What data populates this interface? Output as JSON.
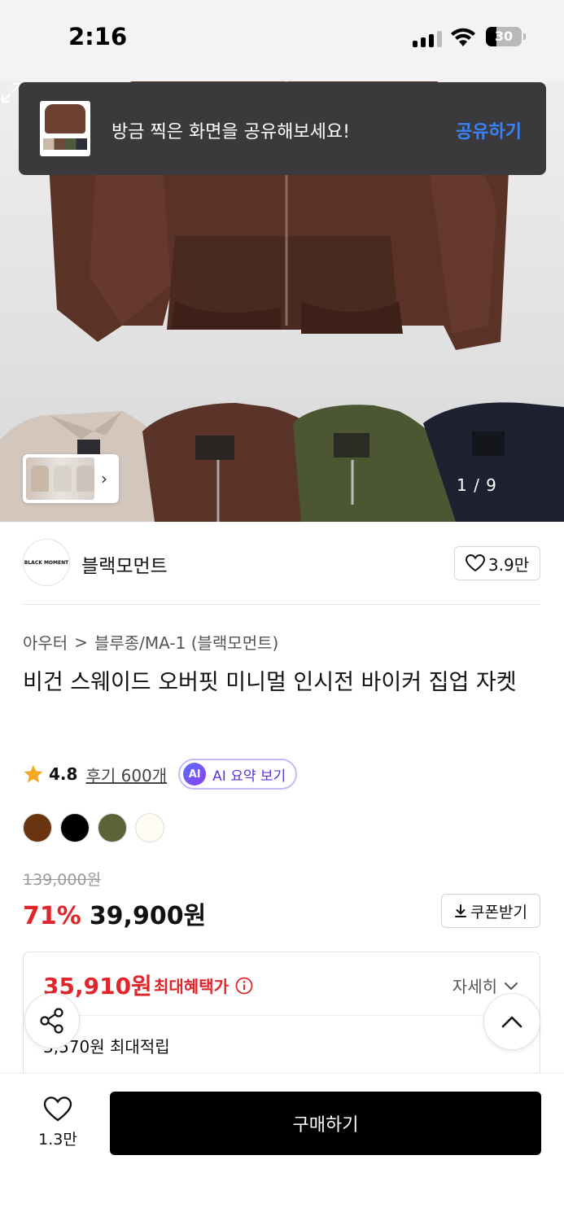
{
  "status_bar": {
    "time": "2:16",
    "battery": "30",
    "battery_level": 0.3
  },
  "toast": {
    "message": "방금 찍은 화면을 공유해보세요!",
    "action": "공유하기"
  },
  "gallery": {
    "counter": "1 / 9",
    "current": 1,
    "total": 9
  },
  "brand": {
    "logo_text": "BLACK MOMENT",
    "name": "블랙모먼트",
    "likes": "3.9만"
  },
  "breadcrumb": {
    "category": "아우터",
    "separator": ">",
    "subcategory": "블루종/MA-1 (블랙모먼트)"
  },
  "product": {
    "title": "비건 스웨이드 오버핏 미니멀 인시전 바이커 집업 자켓"
  },
  "rating": {
    "score": "4.8",
    "reviews": "후기 600개",
    "ai_badge": "AI",
    "ai_label": "AI 요약 보기"
  },
  "colors": [
    "#6b3410",
    "#000000",
    "#5c6338",
    "#fffdf2"
  ],
  "pricing": {
    "original_price": "139,000원",
    "discount": "71%",
    "price": "39,900원",
    "coupon_label": "쿠폰받기"
  },
  "benefit": {
    "max_benefit_price": "35,910원",
    "max_benefit_label": "최대혜택가",
    "detail_label": "자세히",
    "points_text": "3,570원 최대적립"
  },
  "bottom_bar": {
    "wish_count": "1.3만",
    "buy_label": "구매하기"
  },
  "icons": {
    "wifi": "wifi-icon",
    "signal": "signal-icon",
    "battery": "battery-icon",
    "expand": "expand-icon",
    "heart": "heart-icon",
    "star": "star-icon",
    "info": "info-icon",
    "chevron_down": "chevron-down-icon",
    "download": "download-icon",
    "share": "share-icon",
    "chevron_up": "chevron-up-icon",
    "chevron_right": "chevron-right-icon"
  },
  "accent_colors": {
    "sale_red": "#e0262b",
    "link_blue": "#3b82f6",
    "ai_purple": "#5a34d6"
  }
}
